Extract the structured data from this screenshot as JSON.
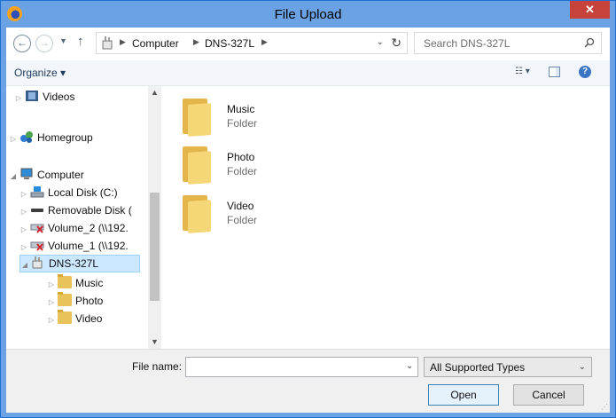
{
  "window": {
    "title": "File Upload",
    "close_label": "✕"
  },
  "address": {
    "crumbs": [
      "Computer",
      "DNS-327L"
    ],
    "search_placeholder": "Search DNS-327L"
  },
  "toolbar": {
    "organize_label": "Organize ▾",
    "help_label": "?"
  },
  "nav_tree": [
    {
      "label": "Videos",
      "icon": "video-library-icon"
    },
    {
      "label": "Homegroup",
      "icon": "homegroup-icon"
    },
    {
      "label": "Computer",
      "icon": "computer-icon"
    },
    {
      "label": "Local Disk (C:)",
      "icon": "local-disk-icon"
    },
    {
      "label": "Removable Disk (",
      "icon": "removable-disk-icon"
    },
    {
      "label": "Volume_2 (\\\\192.",
      "icon": "network-drive-disconnected-icon"
    },
    {
      "label": "Volume_1 (\\\\192.",
      "icon": "network-drive-disconnected-icon"
    },
    {
      "label": "DNS-327L",
      "icon": "nas-device-icon",
      "selected": true
    },
    {
      "label": "Music",
      "icon": "folder-icon"
    },
    {
      "label": "Photo",
      "icon": "folder-icon"
    },
    {
      "label": "Video",
      "icon": "folder-icon"
    }
  ],
  "files": [
    {
      "name": "Music",
      "type": "Folder"
    },
    {
      "name": "Photo",
      "type": "Folder"
    },
    {
      "name": "Video",
      "type": "Folder"
    }
  ],
  "bottom": {
    "file_name_label": "File name:",
    "file_name_value": "",
    "file_type": "All Supported Types",
    "open_label": "Open",
    "cancel_label": "Cancel"
  }
}
